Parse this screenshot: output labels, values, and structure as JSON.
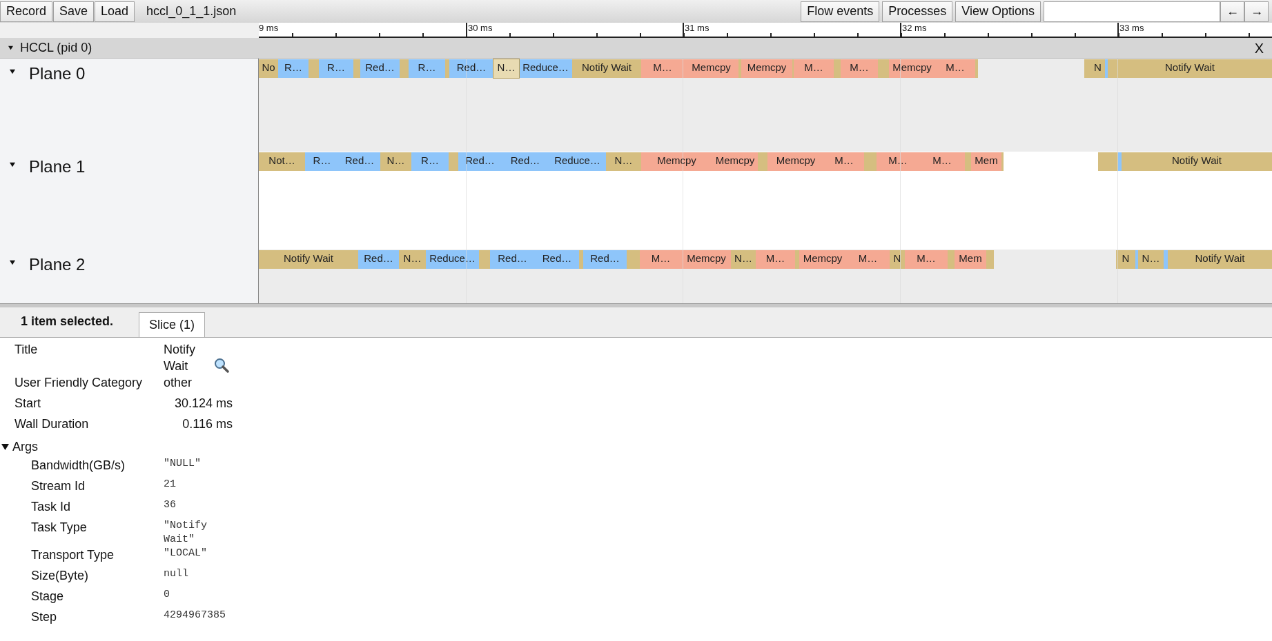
{
  "toolbar": {
    "buttons": [
      "Record",
      "Save",
      "Load"
    ],
    "filename": "hccl_0_1_1.json",
    "right_buttons": [
      "Flow events",
      "Processes",
      "View Options"
    ],
    "nav": [
      "←",
      "→"
    ]
  },
  "ruler": {
    "ticks": [
      "9 ms",
      "30 ms",
      "31 ms",
      "32 ms",
      "33 ms"
    ]
  },
  "process": {
    "title": "HCCL (pid 0)",
    "expanded": true,
    "close": "X"
  },
  "threads": [
    {
      "name": "Plane 0",
      "expanded": true,
      "slices": [
        {
          "label": "No",
          "color": "#d5be80",
          "selected": false
        },
        {
          "label": "R…",
          "color": "#8ec5fa",
          "selected": false
        },
        {
          "color": "#d5be80",
          "selected": false
        },
        {
          "label": "R…",
          "color": "#8ec5fa",
          "selected": false
        },
        {
          "color": "#d5be80",
          "selected": false
        },
        {
          "label": "Red…",
          "color": "#8ec5fa",
          "selected": false
        },
        {
          "color": "#d5be80",
          "selected": false
        },
        {
          "label": "R…",
          "color": "#8ec5fa",
          "selected": false
        },
        {
          "color": "#d5be80",
          "selected": false
        },
        {
          "label": "Red…",
          "color": "#8ec5fa",
          "selected": false
        },
        {
          "label": "N…",
          "color": "#e8dbb2",
          "selected": true
        },
        {
          "label": "Reduce…",
          "color": "#8ec5fa",
          "selected": false
        },
        {
          "label": "Notify Wait",
          "color": "#d5be80",
          "selected": false
        },
        {
          "label": "M…",
          "color": "#f5a993",
          "selected": false
        },
        {
          "label": "Memcpy",
          "color": "#f5a993",
          "selected": false
        },
        {
          "color": "#d5be80",
          "selected": false
        },
        {
          "label": "Memcpy",
          "color": "#f5a993",
          "selected": false
        },
        {
          "color": "#d5be80",
          "selected": false
        },
        {
          "label": "M…",
          "color": "#f5a993",
          "selected": false
        },
        {
          "color": "#d5be80",
          "selected": false
        },
        {
          "label": "M…",
          "color": "#f5a993",
          "selected": false
        },
        {
          "color": "#d5be80",
          "selected": false
        },
        {
          "label": "Memcpy",
          "color": "#f5a993",
          "selected": false
        },
        {
          "label": "M…",
          "color": "#f5a993",
          "selected": false
        },
        {
          "color": "#d5be80",
          "selected": false
        },
        {
          "color": "#d5be80",
          "selected": false
        },
        {
          "label": "N",
          "color": "#d5be80",
          "selected": false
        },
        {
          "color": "#8ec5fa",
          "selected": false
        },
        {
          "label": "Notify Wait",
          "color": "#d5be80",
          "selected": false
        }
      ]
    },
    {
      "name": "Plane 1",
      "expanded": true,
      "slices": [
        {
          "label": "Not…",
          "color": "#d5be80",
          "selected": false
        },
        {
          "label": "R…",
          "color": "#8ec5fa",
          "selected": false
        },
        {
          "label": "Red…",
          "color": "#8ec5fa",
          "selected": false
        },
        {
          "label": "N…",
          "color": "#d5be80",
          "selected": false
        },
        {
          "label": "R…",
          "color": "#8ec5fa",
          "selected": false
        },
        {
          "color": "#d5be80",
          "selected": false
        },
        {
          "label": "Red…",
          "color": "#8ec5fa",
          "selected": false
        },
        {
          "label": "Red…",
          "color": "#8ec5fa",
          "selected": false
        },
        {
          "label": "Reduce…",
          "color": "#8ec5fa",
          "selected": false
        },
        {
          "label": "N…",
          "color": "#d5be80",
          "selected": false
        },
        {
          "label": "Memcpy",
          "color": "#f5a993",
          "selected": false
        },
        {
          "label": "Memcpy",
          "color": "#f5a993",
          "selected": false
        },
        {
          "color": "#d5be80",
          "selected": false
        },
        {
          "label": "Memcpy",
          "color": "#f5a993",
          "selected": false
        },
        {
          "label": "M…",
          "color": "#f5a993",
          "selected": false
        },
        {
          "color": "#d5be80",
          "selected": false
        },
        {
          "label": "M…",
          "color": "#f5a993",
          "selected": false
        },
        {
          "label": "M…",
          "color": "#f5a993",
          "selected": false
        },
        {
          "color": "#d5be80",
          "selected": false
        },
        {
          "label": "Mem",
          "color": "#f5a993",
          "selected": false
        },
        {
          "color": "#d5be80",
          "selected": false
        },
        {
          "color": "#d5be80",
          "selected": false
        },
        {
          "color": "#8ec5fa",
          "selected": false
        },
        {
          "label": "Notify Wait",
          "color": "#d5be80",
          "selected": false
        }
      ]
    },
    {
      "name": "Plane 2",
      "expanded": true,
      "slices": [
        {
          "label": "Notify Wait",
          "color": "#d5be80",
          "selected": false
        },
        {
          "label": "Red…",
          "color": "#8ec5fa",
          "selected": false
        },
        {
          "label": "N…",
          "color": "#d5be80",
          "selected": false
        },
        {
          "label": "Reduce…",
          "color": "#8ec5fa",
          "selected": false
        },
        {
          "color": "#d5be80",
          "selected": false
        },
        {
          "label": "Red…",
          "color": "#8ec5fa",
          "selected": false
        },
        {
          "label": "Red…",
          "color": "#8ec5fa",
          "selected": false
        },
        {
          "color": "#d5be80",
          "selected": false
        },
        {
          "label": "Red…",
          "color": "#8ec5fa",
          "selected": false
        },
        {
          "color": "#d5be80",
          "selected": false
        },
        {
          "label": "M…",
          "color": "#f5a993",
          "selected": false
        },
        {
          "label": "Memcpy",
          "color": "#f5a993",
          "selected": false
        },
        {
          "label": "N…",
          "color": "#d5be80",
          "selected": false
        },
        {
          "label": "M…",
          "color": "#f5a993",
          "selected": false
        },
        {
          "color": "#d5be80",
          "selected": false
        },
        {
          "label": "Memcpy",
          "color": "#f5a993",
          "selected": false
        },
        {
          "label": "M…",
          "color": "#f5a993",
          "selected": false
        },
        {
          "label": "N",
          "color": "#d5be80",
          "selected": false
        },
        {
          "label": "M…",
          "color": "#f5a993",
          "selected": false
        },
        {
          "color": "#d5be80",
          "selected": false
        },
        {
          "label": "Mem",
          "color": "#f5a993",
          "selected": false
        },
        {
          "color": "#d5be80",
          "selected": false
        },
        {
          "label": "N",
          "color": "#d5be80",
          "selected": false
        },
        {
          "color": "#8ec5fa",
          "selected": false
        },
        {
          "label": "N…",
          "color": "#d5be80",
          "selected": false
        },
        {
          "color": "#8ec5fa",
          "selected": false
        },
        {
          "label": "Notify Wait",
          "color": "#d5be80",
          "selected": false
        }
      ]
    }
  ],
  "details": {
    "summary": "1 item selected.",
    "tabs": [
      {
        "label": "Slice (1)",
        "selected": true
      }
    ],
    "fields": [
      {
        "kind": "title",
        "label": "Title",
        "value": "Notify Wait"
      },
      {
        "kind": "text",
        "label": "User Friendly Category",
        "value": "other"
      },
      {
        "kind": "time",
        "label": "Start",
        "value": "30.124 ms"
      },
      {
        "kind": "time",
        "label": "Wall Duration",
        "value": "0.116 ms"
      }
    ],
    "args": {
      "label": "Args",
      "expanded": true,
      "rows": [
        {
          "label": "Bandwidth(GB/s)",
          "value": "\"NULL\""
        },
        {
          "label": "Stream Id",
          "value": "21"
        },
        {
          "label": "Task Id",
          "value": "36"
        },
        {
          "label": "Task Type",
          "value": "\"Notify Wait\""
        },
        {
          "label": "Transport Type",
          "value": "\"LOCAL\""
        },
        {
          "label": "Size(Byte)",
          "value": "null"
        },
        {
          "label": "Stage",
          "value": "0"
        },
        {
          "label": "Step",
          "value": "4294967385"
        }
      ]
    }
  }
}
